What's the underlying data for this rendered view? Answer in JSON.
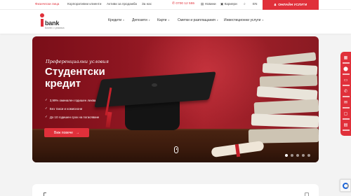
{
  "topbar": {
    "links": [
      "Физически лица",
      "Корпоративни клиенти",
      "Активи за продажба",
      "За нас"
    ],
    "phone": "0700 12 555",
    "news": "Новини",
    "careers": "Кариери",
    "lang": "EN",
    "online_button": "ОНЛАЙН УСЛУГИ"
  },
  "logo": {
    "word": "bank",
    "tagline": "Бизнес с усмивка"
  },
  "nav": {
    "items": [
      "Кредити",
      "Депозити",
      "Карти",
      "Сметки и разплащания",
      "Инвестиционни услуги"
    ]
  },
  "hero": {
    "kicker": "Преференциални условия",
    "title": "Студентски кредит",
    "bullets": [
      "3,99% оминален годишен лихва",
      "Без такси и комисиони",
      "До 10 годишен срок на погасяване"
    ],
    "cta_label": "Виж повече",
    "slides_count": 5,
    "active_slide": 0
  },
  "colors": {
    "brand": "#e0303a",
    "hero_bg": "#8c1520"
  }
}
